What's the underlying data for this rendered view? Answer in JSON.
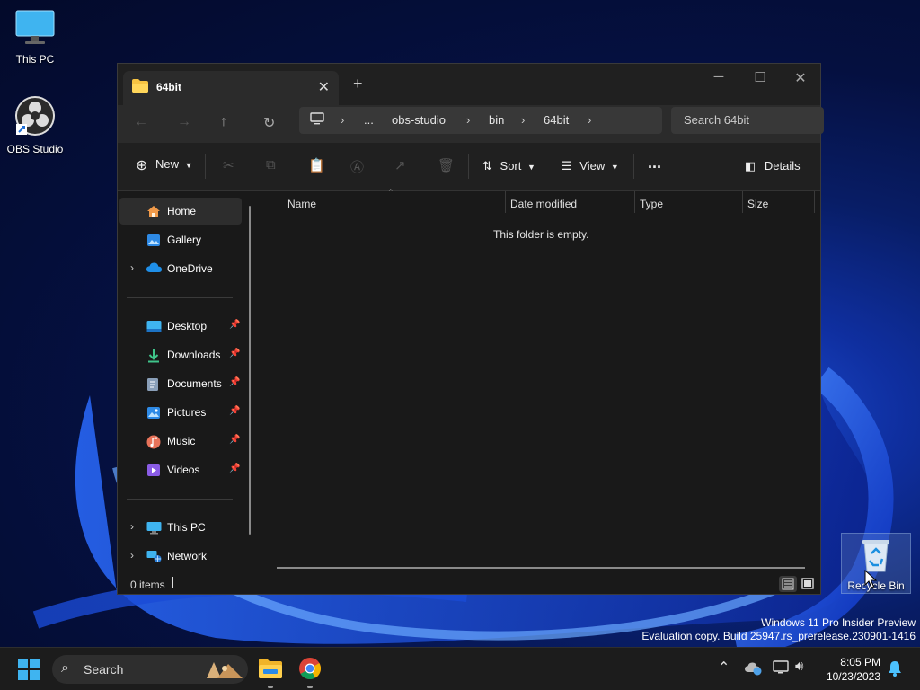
{
  "desktop": {
    "icons": [
      {
        "label": "This PC"
      },
      {
        "label": "OBS Studio"
      },
      {
        "label": "Recycle Bin"
      }
    ],
    "watermark": {
      "line1": "Windows 11 Pro Insider Preview",
      "line2": "Evaluation copy. Build 25947.rs_prerelease.230901-1416"
    }
  },
  "explorer": {
    "tab_title": "64bit",
    "tab_icon": "folder-icon",
    "new_tab_label": "+",
    "breadcrumb": [
      "...",
      "obs-studio",
      "bin",
      "64bit"
    ],
    "search_placeholder": "Search 64bit",
    "toolbar": {
      "new_label": "New",
      "sort_label": "Sort",
      "view_label": "View",
      "more_label": "...",
      "details_label": "Details"
    },
    "sidebar": {
      "top": [
        {
          "label": "Home",
          "icon": "home-icon",
          "selected": true
        },
        {
          "label": "Gallery",
          "icon": "gallery-icon"
        },
        {
          "label": "OneDrive",
          "icon": "cloud-icon",
          "expandable": true
        }
      ],
      "pinned": [
        {
          "label": "Desktop",
          "icon": "desktop-folder-icon"
        },
        {
          "label": "Downloads",
          "icon": "download-icon"
        },
        {
          "label": "Documents",
          "icon": "document-icon"
        },
        {
          "label": "Pictures",
          "icon": "pictures-icon"
        },
        {
          "label": "Music",
          "icon": "music-icon"
        },
        {
          "label": "Videos",
          "icon": "videos-icon"
        }
      ],
      "bottom": [
        {
          "label": "This PC",
          "icon": "computer-icon"
        },
        {
          "label": "Network",
          "icon": "network-icon"
        }
      ]
    },
    "columns": [
      "Name",
      "Date modified",
      "Type",
      "Size"
    ],
    "empty_message": "This folder is empty.",
    "status": {
      "item_count": "0 items"
    }
  },
  "taskbar": {
    "search_label": "Search",
    "time": "8:05 PM",
    "date": "10/23/2023"
  },
  "colors": {
    "accent": "#4cc2ff",
    "window_bg": "#191919",
    "folder_yellow": "#f6c342"
  }
}
